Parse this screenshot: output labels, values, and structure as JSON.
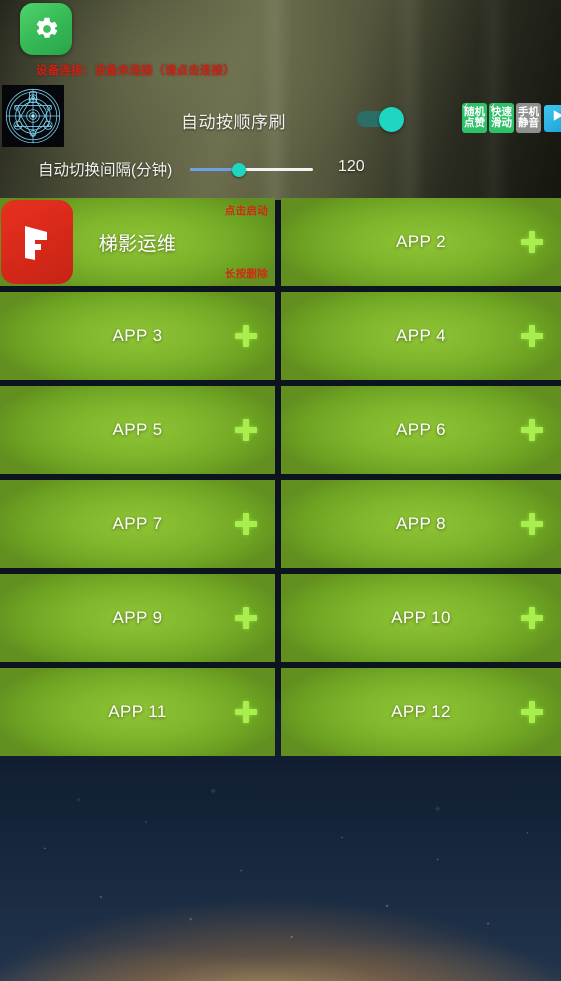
{
  "header": {
    "gear_icon": "gear-icon",
    "status_text": "设备连接：设备未连接（请点击连接）",
    "compass_icon": "magic-circle-icon"
  },
  "controls": {
    "auto_order_label": "自动按顺序刷",
    "auto_order_toggle_state": "on",
    "interval_label": "自动切换间隔(分钟)",
    "interval_value": "120",
    "interval_percent": 40
  },
  "chips": [
    {
      "line1": "随机",
      "line2": "点赞",
      "state": "on",
      "checked": true
    },
    {
      "line1": "快速",
      "line2": "滑动",
      "state": "on",
      "checked": true
    },
    {
      "line1": "手机",
      "line2": "静音",
      "state": "off",
      "checked": false
    }
  ],
  "play_button": {
    "icon": "play-icon"
  },
  "cards": [
    {
      "title": "梯影运维",
      "has_icon": true,
      "has_plus": false,
      "hint_top": "点击启动",
      "hint_bottom": "长按删除",
      "icon": "tiying-app-icon"
    },
    {
      "title": "APP 2",
      "has_icon": false,
      "has_plus": true,
      "hint_top": "",
      "hint_bottom": ""
    },
    {
      "title": "APP 3",
      "has_icon": false,
      "has_plus": true,
      "hint_top": "",
      "hint_bottom": ""
    },
    {
      "title": "APP 4",
      "has_icon": false,
      "has_plus": true,
      "hint_top": "",
      "hint_bottom": ""
    },
    {
      "title": "APP 5",
      "has_icon": false,
      "has_plus": true,
      "hint_top": "",
      "hint_bottom": ""
    },
    {
      "title": "APP 6",
      "has_icon": false,
      "has_plus": true,
      "hint_top": "",
      "hint_bottom": ""
    },
    {
      "title": "APP 7",
      "has_icon": false,
      "has_plus": true,
      "hint_top": "",
      "hint_bottom": ""
    },
    {
      "title": "APP 8",
      "has_icon": false,
      "has_plus": true,
      "hint_top": "",
      "hint_bottom": ""
    },
    {
      "title": "APP 9",
      "has_icon": false,
      "has_plus": true,
      "hint_top": "",
      "hint_bottom": ""
    },
    {
      "title": "APP 10",
      "has_icon": false,
      "has_plus": true,
      "hint_top": "",
      "hint_bottom": ""
    },
    {
      "title": "APP 11",
      "has_icon": false,
      "has_plus": true,
      "hint_top": "",
      "hint_bottom": ""
    },
    {
      "title": "APP 12",
      "has_icon": false,
      "has_plus": true,
      "hint_top": "",
      "hint_bottom": ""
    }
  ],
  "colors": {
    "card_green": "#7fb52c",
    "plus_green": "#a8ee4c",
    "chip_on": "#2fc06a",
    "chip_off": "#8f8f8f",
    "toggle_on": "#1fd6c0",
    "status_red": "#d02012",
    "hint_red": "#d22a14",
    "slider_fill": "#6ca0e8",
    "play_blue": "#1b9fd8"
  }
}
